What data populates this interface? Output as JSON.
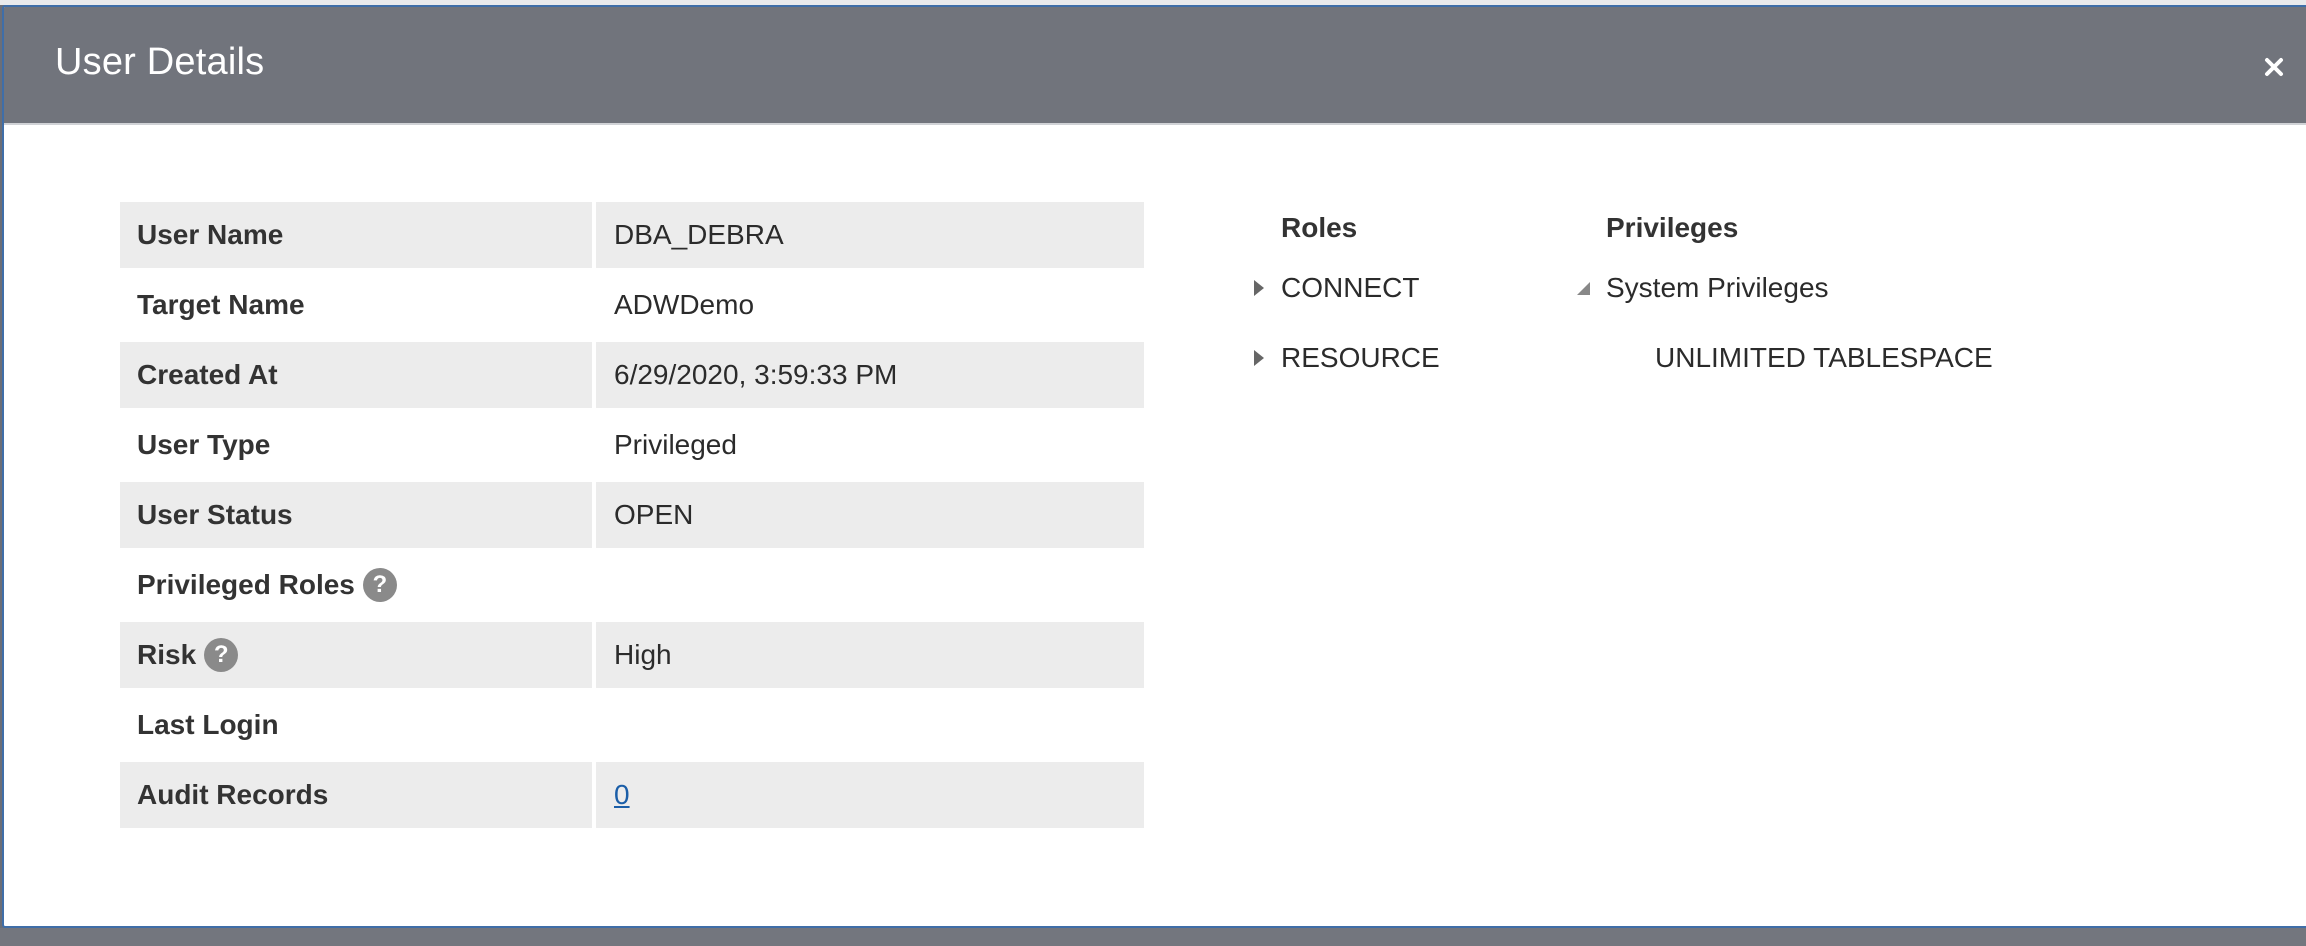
{
  "dialog": {
    "title": "User Details",
    "close_icon": "close-icon"
  },
  "details": [
    {
      "label": "User Name",
      "value": "DBA_DEBRA",
      "shaded": true
    },
    {
      "label": "Target Name",
      "value": "ADWDemo",
      "shaded": false
    },
    {
      "label": "Created At",
      "value": "6/29/2020, 3:59:33 PM",
      "shaded": true
    },
    {
      "label": "User Type",
      "value": "Privileged",
      "shaded": false
    },
    {
      "label": "User Status",
      "value": "OPEN",
      "shaded": true
    },
    {
      "label": "Privileged Roles",
      "value": "",
      "shaded": false,
      "help": true
    },
    {
      "label": "Risk",
      "value": "High",
      "shaded": true,
      "help": true
    },
    {
      "label": "Last Login",
      "value": "",
      "shaded": false
    },
    {
      "label": "Audit Records",
      "value": "0",
      "shaded": true,
      "link": true
    }
  ],
  "help_glyph": "?",
  "roles": {
    "header": "Roles",
    "items": [
      {
        "label": "CONNECT",
        "expanded": false
      },
      {
        "label": "RESOURCE",
        "expanded": false
      }
    ]
  },
  "privileges": {
    "header": "Privileges",
    "group": {
      "label": "System Privileges",
      "expanded": true,
      "children": [
        "UNLIMITED TABLESPACE"
      ]
    }
  },
  "colors": {
    "header_bg": "#71747c",
    "row_shade": "#ececec",
    "link": "#1b5ea8",
    "dialog_border": "#3f6ea8"
  }
}
